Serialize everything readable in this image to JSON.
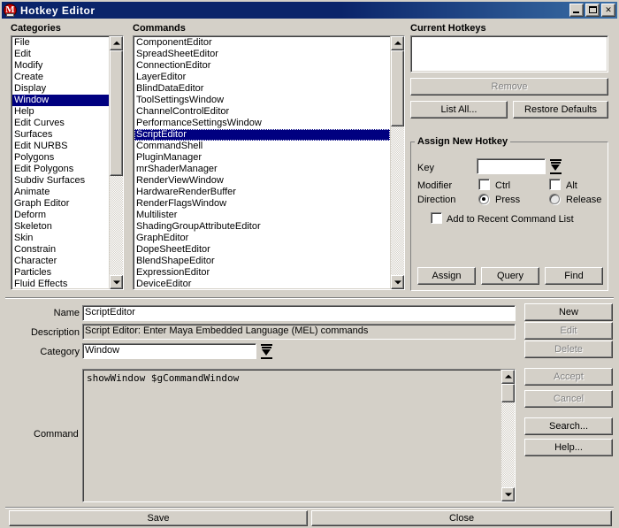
{
  "window": {
    "title": "Hotkey  Editor",
    "icon": "maya-m-icon",
    "minimize_label": "Minimize",
    "maximize_label": "Maximize",
    "close_label": "✕"
  },
  "categories": {
    "label": "Categories",
    "selected": "Window",
    "items": [
      "File",
      "Edit",
      "Modify",
      "Create",
      "Display",
      "Window",
      "Help",
      "Edit Curves",
      "Surfaces",
      "Edit NURBS",
      "Polygons",
      "Edit Polygons",
      "Subdiv Surfaces",
      "Animate",
      "Graph Editor",
      "Deform",
      "Skeleton",
      "Skin",
      "Constrain",
      "Character",
      "Particles",
      "Fluid Effects"
    ],
    "scroll": {
      "thumb_top_pct": 0,
      "thumb_height_pct": 56
    }
  },
  "commands": {
    "label": "Commands",
    "selected": "ScriptEditor",
    "items": [
      "ComponentEditor",
      "SpreadSheetEditor",
      "ConnectionEditor",
      "LayerEditor",
      "BlindDataEditor",
      "ToolSettingsWindow",
      "ChannelControlEditor",
      "PerformanceSettingsWindow",
      "ScriptEditor",
      "CommandShell",
      "PluginManager",
      "mrShaderManager",
      "RenderViewWindow",
      "HardwareRenderBuffer",
      "RenderFlagsWindow",
      "Multilister",
      "ShadingGroupAttributeEditor",
      "GraphEditor",
      "DopeSheetEditor",
      "BlendShapeEditor",
      "ExpressionEditor",
      "DeviceEditor"
    ],
    "scroll": {
      "thumb_top_pct": 0,
      "thumb_height_pct": 34
    }
  },
  "current_hotkeys": {
    "label": "Current Hotkeys",
    "items": [],
    "remove_label": "Remove",
    "remove_enabled": false,
    "list_all_label": "List All...",
    "restore_defaults_label": "Restore Defaults"
  },
  "assign_new_hotkey": {
    "title": "Assign New Hotkey",
    "key_label": "Key",
    "key_value": "",
    "modifier_label": "Modifier",
    "ctrl_label": "Ctrl",
    "ctrl_checked": false,
    "alt_label": "Alt",
    "alt_checked": false,
    "direction_label": "Direction",
    "press_label": "Press",
    "press_checked": true,
    "release_label": "Release",
    "release_checked": false,
    "recent_label": "Add to Recent Command List",
    "recent_checked": false,
    "assign_label": "Assign",
    "query_label": "Query",
    "find_label": "Find"
  },
  "details": {
    "name_label": "Name",
    "name_value": "ScriptEditor",
    "description_label": "Description",
    "description_value": "Script Editor: Enter Maya Embedded Language (MEL) commands",
    "category_label": "Category",
    "category_value": "Window",
    "command_label": "Command",
    "command_value": "showWindow $gCommandWindow",
    "command_scroll": {
      "thumb_top_pct": 0,
      "thumb_height_pct": 18
    }
  },
  "side_buttons": [
    {
      "label": "New",
      "enabled": true
    },
    {
      "label": "Edit",
      "enabled": false
    },
    {
      "label": "Delete",
      "enabled": false
    },
    {
      "label": "Accept",
      "enabled": false
    },
    {
      "label": "Cancel",
      "enabled": false
    },
    {
      "label": "Search...",
      "enabled": true
    },
    {
      "label": "Help...",
      "enabled": true
    }
  ],
  "footer": {
    "save_label": "Save",
    "close_label": "Close"
  },
  "colors": {
    "face": "#d4d0c8",
    "title_active": "#0a246a",
    "selection": "#000080",
    "disabled_text": "#808080"
  }
}
